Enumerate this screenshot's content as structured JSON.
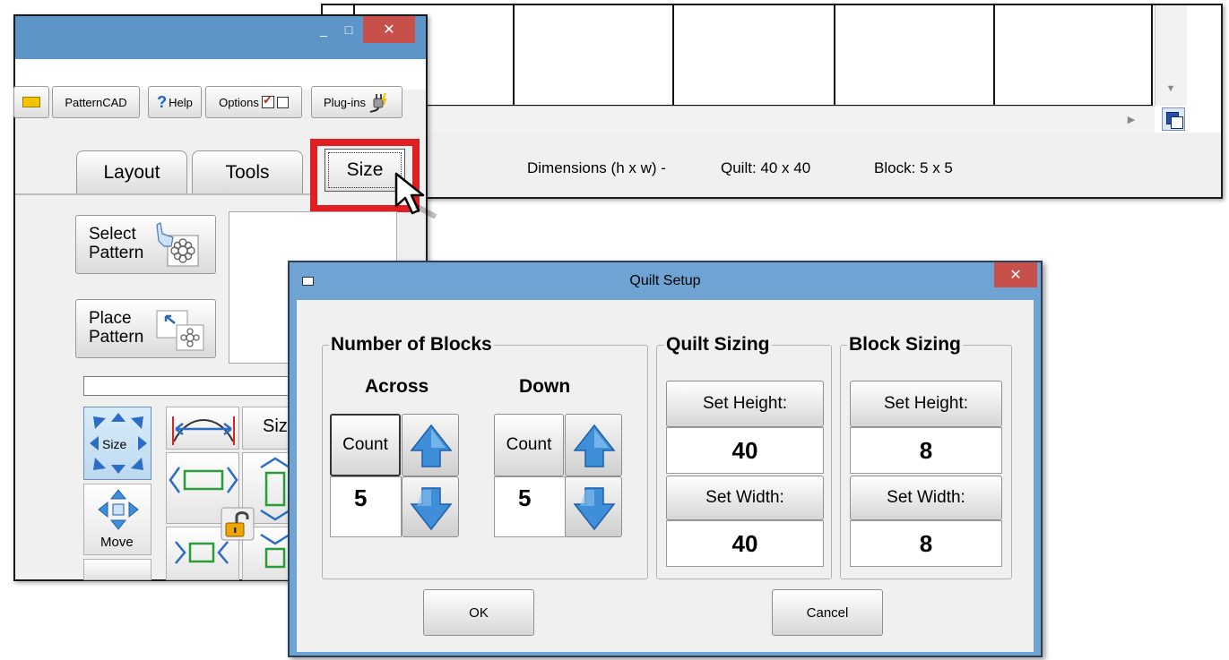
{
  "canvas": {
    "status": {
      "dimensions_label": "Dimensions (h x w) -",
      "quilt": "Quilt: 40 x 40",
      "block": "Block: 5 x 5"
    }
  },
  "app": {
    "title_controls": {
      "minimize": "_",
      "maximize": "□",
      "close": "✕"
    },
    "toolbar": {
      "patterncad": "PatternCAD",
      "help_mark": "?",
      "help": "Help",
      "options": "Options",
      "plugins": "Plug-ins"
    },
    "tabs": {
      "layout": "Layout",
      "tools": "Tools",
      "size": "Size"
    },
    "select_pattern": [
      "Select",
      "Pattern"
    ],
    "place_pattern": [
      "Place",
      "Pattern"
    ],
    "tools": {
      "size_icon": "Size",
      "size_btn": "Size",
      "move": "Move"
    }
  },
  "dialog": {
    "title": "Quilt Setup",
    "close": "✕",
    "number_of_blocks": {
      "title": "Number of Blocks",
      "across": {
        "label": "Across",
        "count_btn": "Count",
        "value": "5"
      },
      "down": {
        "label": "Down",
        "count_btn": "Count",
        "value": "5"
      }
    },
    "quilt_sizing": {
      "title": "Quilt Sizing",
      "set_height": "Set Height:",
      "height": "40",
      "set_width": "Set Width:",
      "width": "40"
    },
    "block_sizing": {
      "title": "Block Sizing",
      "set_height": "Set Height:",
      "height": "8",
      "set_width": "Set Width:",
      "width": "8"
    },
    "ok": "OK",
    "cancel": "Cancel"
  },
  "colors": {
    "title_bar": "#5e95c9",
    "dialog_frame": "#6fa3d4",
    "close_red": "#c7504a",
    "highlight_red": "#e01e24",
    "arrow_blue": "#3f8fd8"
  }
}
